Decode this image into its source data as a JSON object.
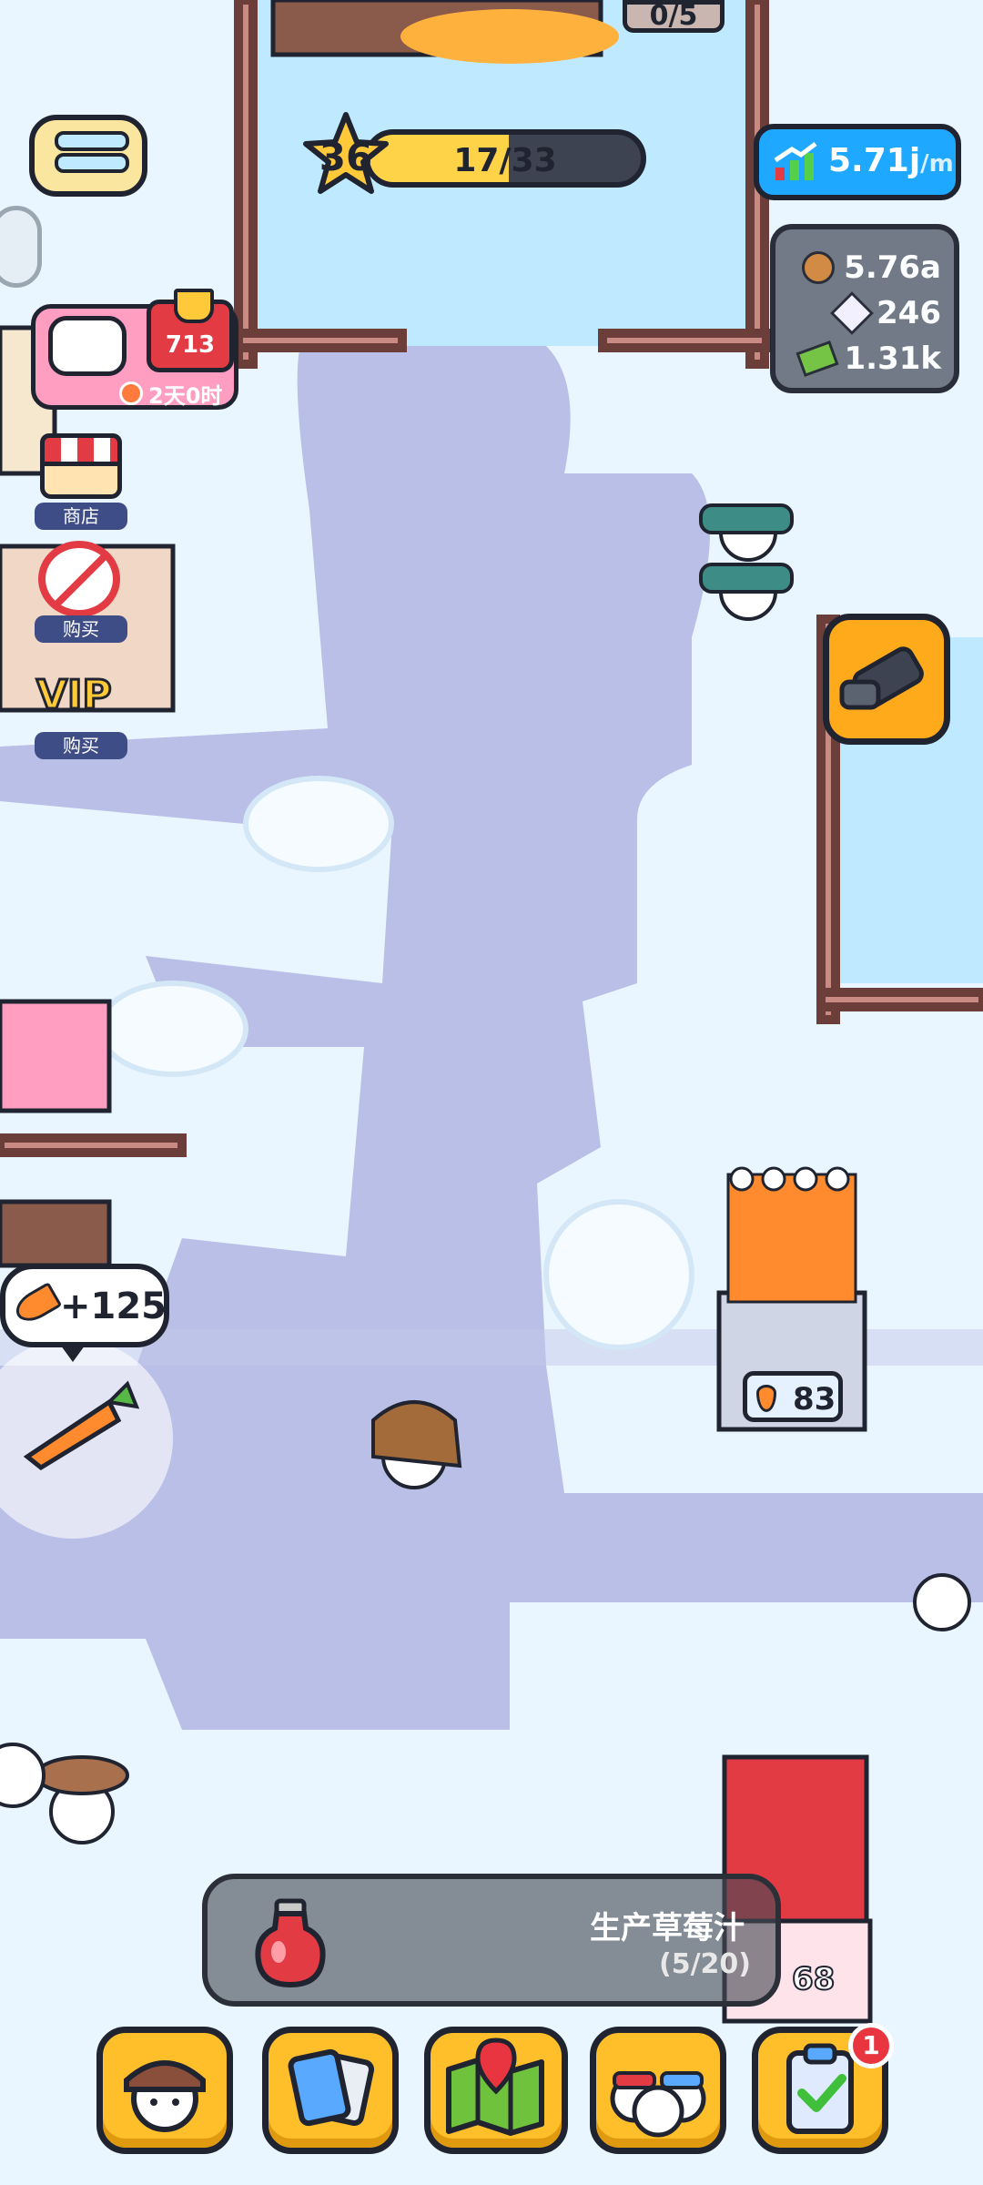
{
  "hud": {
    "level": "36",
    "xp_text": "17/33",
    "xp_progress": 0.515,
    "income_rate": "5.71j",
    "income_unit": "/m",
    "resources": [
      {
        "icon": "cookie-icon",
        "value": "5.76a"
      },
      {
        "icon": "gem-icon",
        "value": "246"
      },
      {
        "icon": "cash-icon",
        "value": "1.31k"
      }
    ]
  },
  "event": {
    "trophy_count": "713",
    "timer": "2天0时"
  },
  "left_menu": {
    "shop_label": "商店",
    "buy_label_1": "购买",
    "vip_text": "VIP",
    "buy_label_2": "购买"
  },
  "world": {
    "top_counter": "0/5",
    "carrot_stand_count": "83",
    "juice_stand_count": "68",
    "carrot_gain": "+125"
  },
  "production": {
    "title": "生产草莓汁",
    "progress": "(5/20)"
  },
  "dock": {
    "notification_count": "1"
  },
  "colors": {
    "accent_yellow": "#ffbf2a",
    "rate_blue": "#1fa8ff",
    "outline": "#1f2430"
  }
}
